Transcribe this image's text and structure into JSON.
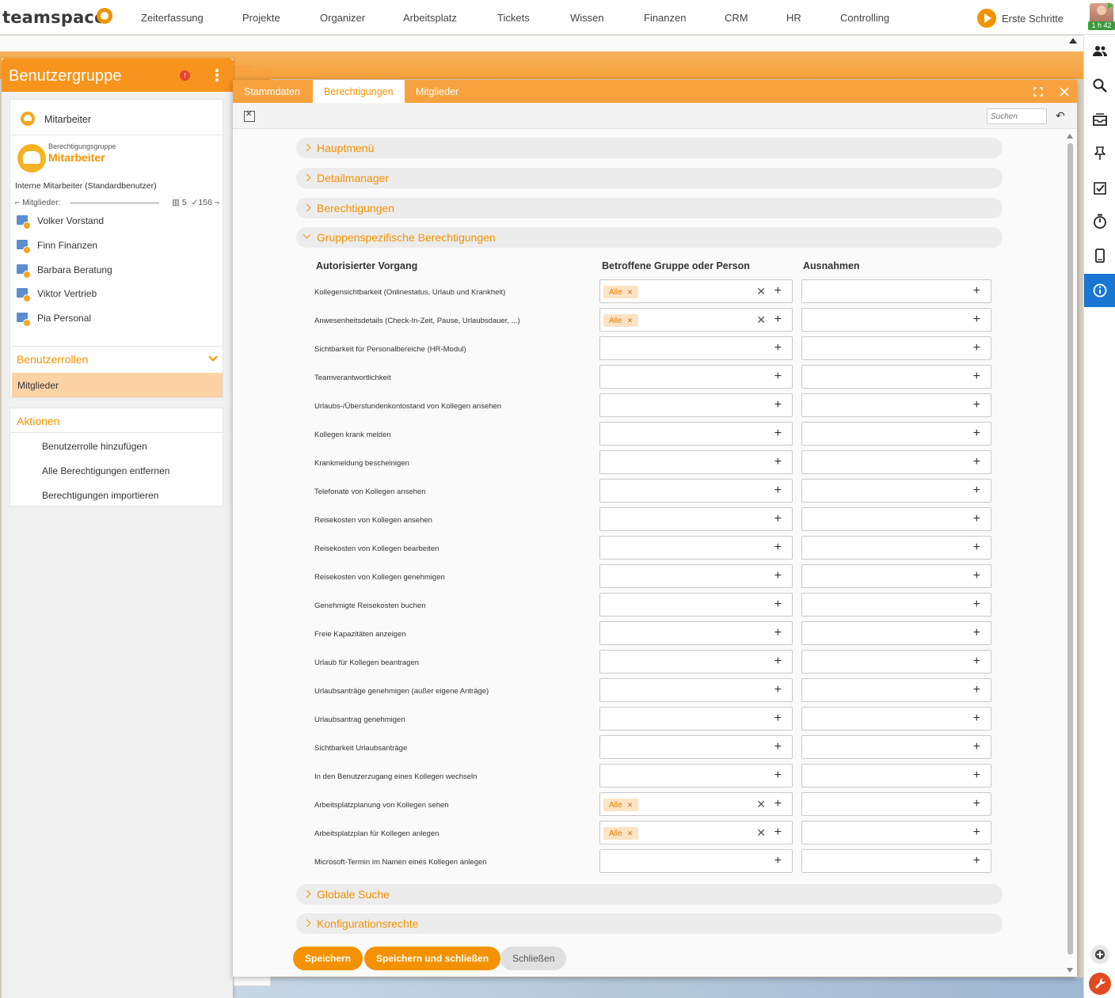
{
  "app": {
    "logo": "teamspace",
    "nav": [
      "Zeiterfassung",
      "Projekte",
      "Organizer",
      "Arbeitsplatz",
      "Tickets",
      "Wissen",
      "Finanzen",
      "CRM",
      "HR",
      "Controlling"
    ],
    "erste_schritte": "Erste Schritte",
    "timer": "1 h 42"
  },
  "left_panel": {
    "title": "Benutzergruppe",
    "alert_count": "!",
    "group_name": "Mitarbeiter",
    "badge_label": "Berechtigungsgruppe",
    "badge_name": "Mitarbeiter",
    "description": "Interne Mitarbeiter (Standardbenutzer)",
    "members_label": "Mitglieder:",
    "member_count_a": "5",
    "member_count_b": "156",
    "members": [
      "Volker Vorstand",
      "Finn Finanzen",
      "Barbara Beratung",
      "Viktor Vertrieb",
      "Pia Personal"
    ],
    "roles_title": "Benutzerrollen",
    "roles_selected": "Mitglieder",
    "actions_title": "Aktionen",
    "actions": [
      "Benutzerrolle hinzufügen",
      "Alle Berechtigungen entfernen",
      "Berechtigungen importieren"
    ]
  },
  "dialog": {
    "tabs": [
      "Stammdaten",
      "Berechtigungen",
      "Mitglieder"
    ],
    "active_tab": "Berechtigungen",
    "search_placeholder": "Suchen",
    "sections_top": [
      "Hauptmenü",
      "Detailmanager",
      "Berechtigungen",
      "Gruppenspezifische Berechtigungen"
    ],
    "sections_bottom": [
      "Globale Suche",
      "Konfigurationsrechte"
    ],
    "columns": [
      "Autorisierter Vorgang",
      "Betroffene Gruppe oder Person",
      "Ausnahmen"
    ],
    "permissions": [
      {
        "label": "Kollegensichtbarkeit (Onlinestatus, Urlaub und Krankheit)",
        "group": "Alle",
        "exception": ""
      },
      {
        "label": "Anwesenheitsdetails (Check-In-Zeit, Pause, Urlaubsdauer, ...)",
        "group": "Alle",
        "exception": ""
      },
      {
        "label": "Sichtbarkeit für Personalbereiche (HR-Modul)",
        "group": "",
        "exception": ""
      },
      {
        "label": "Teamverantwortlichkeit",
        "group": "",
        "exception": ""
      },
      {
        "label": "Urlaubs-/Überstundenkontostand von Kollegen ansehen",
        "group": "",
        "exception": ""
      },
      {
        "label": "Kollegen krank melden",
        "group": "",
        "exception": ""
      },
      {
        "label": "Krankmeldung bescheinigen",
        "group": "",
        "exception": ""
      },
      {
        "label": "Telefonate von Kollegen ansehen",
        "group": "",
        "exception": ""
      },
      {
        "label": "Reisekosten von Kollegen ansehen",
        "group": "",
        "exception": ""
      },
      {
        "label": "Reisekosten von Kollegen bearbeiten",
        "group": "",
        "exception": ""
      },
      {
        "label": "Reisekosten von Kollegen genehmigen",
        "group": "",
        "exception": ""
      },
      {
        "label": "Genehmigte Reisekosten buchen",
        "group": "",
        "exception": ""
      },
      {
        "label": "Freie Kapazitäten anzeigen",
        "group": "",
        "exception": ""
      },
      {
        "label": "Urlaub für Kollegen beantragen",
        "group": "",
        "exception": ""
      },
      {
        "label": "Urlaubsanträge genehmigen (außer eigene Anträge)",
        "group": "",
        "exception": ""
      },
      {
        "label": "Urlaubsantrag genehmigen",
        "group": "",
        "exception": ""
      },
      {
        "label": "Sichtbarkeit Urlaubsanträge",
        "group": "",
        "exception": ""
      },
      {
        "label": "In den Benutzerzugang eines Kollegen wechseln",
        "group": "",
        "exception": ""
      },
      {
        "label": "Arbeitsplatzplanung  von  Kollegen sehen",
        "group": "Alle",
        "exception": ""
      },
      {
        "label": "Arbeitsplatzplan für Kollegen anlegen",
        "group": "Alle",
        "exception": ""
      },
      {
        "label": "Microsoft-Termin im Namen eines Kollegen anlegen",
        "group": "",
        "exception": ""
      }
    ],
    "buttons": {
      "save": "Speichern",
      "save_close": "Speichern und schließen",
      "close": "Schließen"
    }
  },
  "colors": {
    "accent": "#f39200",
    "tabbar": "#f7a23f",
    "info": "#1976d2"
  }
}
